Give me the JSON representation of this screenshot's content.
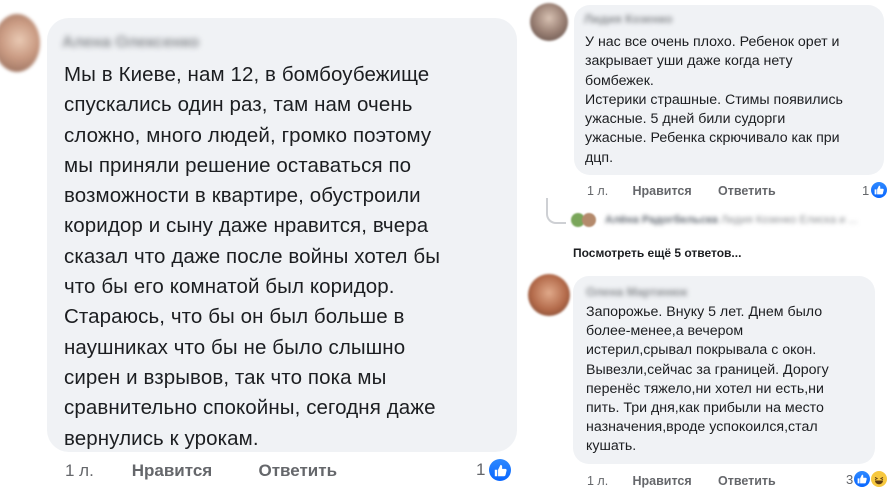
{
  "left_comment": {
    "author": "Алена Олексенко",
    "text_lines": [
      "Мы в Киеве, нам 12, в бомбоубежище",
      "спускались один раз, там нам очень",
      "сложно, много людей, громко поэтому",
      "мы приняли решение оставаться по",
      "возможности в квартире, обустроили",
      "коридор и сыну даже нравится, вчера",
      "сказал что даже после войны хотел бы",
      "что бы его комнатой был коридор.",
      "Стараюсь, что бы он был больше в",
      "наушниках что бы не было слышно",
      "сирен и взрывов, так что пока мы",
      "сравнительно спокойны, сегодня даже",
      "вернулись к урокам."
    ],
    "time": "1 л.",
    "like_label": "Нравится",
    "reply_label": "Ответить",
    "reaction_count": "1",
    "reaction_icon": "like-icon"
  },
  "right_comment_1": {
    "author": "Лидия Козенко",
    "text_lines": [
      "У нас все очень плохо. Ребенок орет и",
      "закрывает уши даже когда нету",
      "бомбежек.",
      "Истерики страшные. Стимы появились",
      "ужасные. 5 дней били судорги",
      "ужасные. Ребенка скрючивало как при",
      "дцп."
    ],
    "time": "1 л.",
    "like_label": "Нравится",
    "reply_label": "Ответить",
    "reaction_count": "1",
    "reaction_icon": "like-icon"
  },
  "replies_preview": {
    "repliers": "Алёна Радогбельска",
    "replier_text": "Лидия Козенко Елиска и ...",
    "more_replies_label": "Посмотреть ещё 5 ответов..."
  },
  "right_comment_2": {
    "author": "Олена Мартинюк",
    "text_lines": [
      "Запорожье. Внуку 5 лет. Днем было",
      "более-менее,а вечером",
      "истерил,срывал покрывала с окон.",
      "Вывезли,сейчас за границей. Дорогу",
      "перенёс тяжело,ни хотел ни есть,ни",
      "пить. Три дня,как прибыли на место",
      "назначения,вроде успокоился,стал",
      "кушать."
    ],
    "time": "1 л.",
    "like_label": "Нравится",
    "reply_label": "Ответить",
    "reaction_count": "3",
    "reaction_icons": [
      "like-icon",
      "haha-icon"
    ]
  },
  "colors": {
    "bubble": "#f0f2f5",
    "text": "#1c1e21",
    "meta": "#65676b",
    "like_blue": "#0866ff"
  }
}
